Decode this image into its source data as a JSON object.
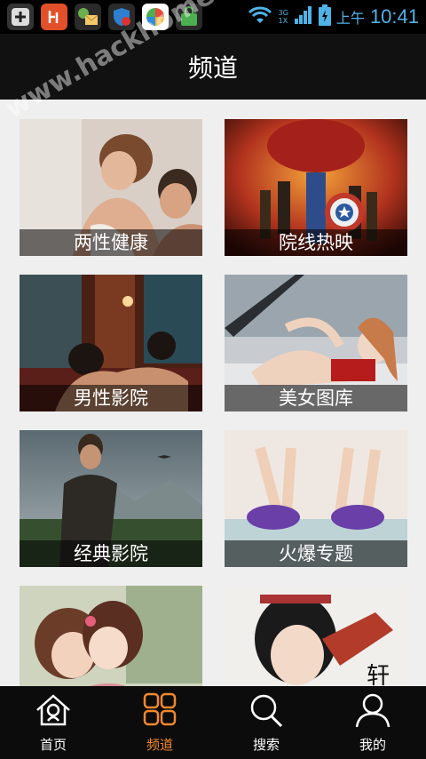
{
  "status_bar": {
    "network": "3G",
    "network_sub": "1X",
    "ampm": "上午",
    "time": "10:41",
    "wifi_icon": "wifi-icon",
    "signal_icon": "signal-icon",
    "battery_icon": "battery-charging-icon"
  },
  "header": {
    "title": "频道"
  },
  "channels": [
    {
      "label": "两性健康",
      "art": "couple-photo"
    },
    {
      "label": "院线热映",
      "art": "movie-poster"
    },
    {
      "label": "男性影院",
      "art": "bed-scene-photo"
    },
    {
      "label": "美女图库",
      "art": "model-in-car-photo"
    },
    {
      "label": "经典影院",
      "art": "landscape-poster"
    },
    {
      "label": "火爆专题",
      "art": "legs-up-photo"
    },
    {
      "label": "",
      "art": "anime-couple-illustration"
    },
    {
      "label": "",
      "art": "costume-portrait-photo"
    }
  ],
  "tabbar": {
    "items": [
      {
        "label": "首页",
        "icon": "home-icon",
        "active": false
      },
      {
        "label": "频道",
        "icon": "grid-icon",
        "active": true
      },
      {
        "label": "搜索",
        "icon": "search-icon",
        "active": false
      },
      {
        "label": "我的",
        "icon": "user-icon",
        "active": false
      }
    ],
    "active_color": "#f2882d"
  },
  "watermark": "www.hackhome.com"
}
